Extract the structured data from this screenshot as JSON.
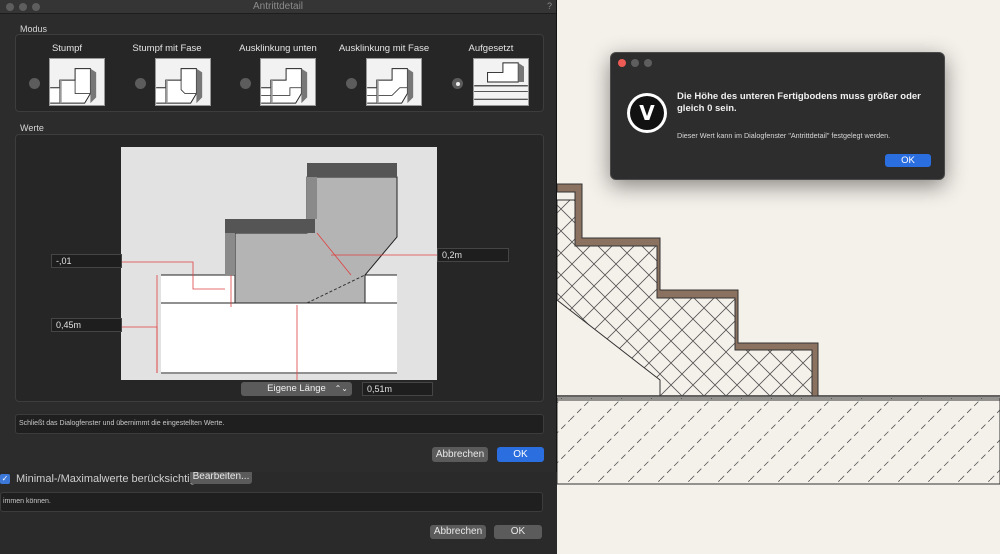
{
  "window": {
    "title": "Antrittdetail",
    "help": "?"
  },
  "modus": {
    "label": "Modus",
    "options": [
      {
        "label": "Stumpf",
        "selected": false
      },
      {
        "label": "Stumpf mit Fase",
        "selected": false
      },
      {
        "label": "Ausklinkung unten",
        "selected": false
      },
      {
        "label": "Ausklinkung mit Fase",
        "selected": false
      },
      {
        "label": "Aufgesetzt",
        "selected": true
      }
    ]
  },
  "werte": {
    "label": "Werte",
    "fields": {
      "left_top": "-,01",
      "left_bottom": "0,45m",
      "right": "0,2m",
      "bottom": "0,51m"
    },
    "length_mode": "Eigene Länge"
  },
  "help_text": "Schließt das Dialogfenster und übernimmt die eingestellten Werte.",
  "buttons": {
    "cancel": "Abbrechen",
    "ok": "OK"
  },
  "background_dialog": {
    "checkbox_label": "Minimal-/Maximalwerte berücksichtigen",
    "edit_button": "Bearbeiten...",
    "hint_text": "immen können.",
    "cancel": "Abbrechen",
    "ok": "OK"
  },
  "alert": {
    "message": "Die Höhe des unteren Fertigbodens muss größer oder gleich 0 sein.",
    "informative": "Dieser Wert kann im Dialogfenster \"Antrittdetail\" festgelegt werden.",
    "ok": "OK",
    "logo_letter": "V"
  },
  "colors": {
    "accent": "#2b6ee0",
    "stair_fill": "#8b7260",
    "paper": "#f4f0ea"
  }
}
